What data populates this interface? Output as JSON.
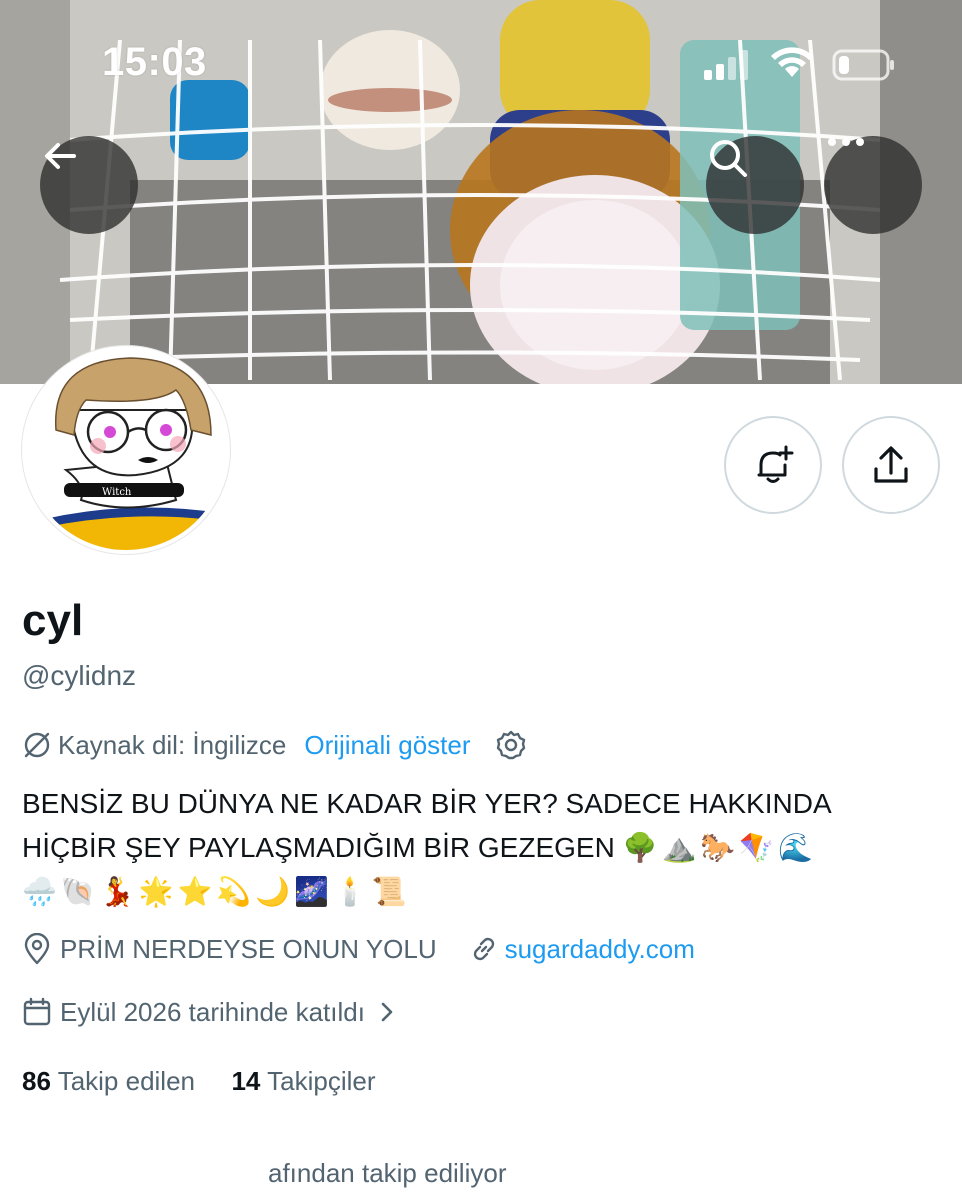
{
  "status_bar": {
    "time": "15:03",
    "icons": [
      "signal-icon",
      "wifi-icon",
      "battery-icon"
    ]
  },
  "header": {
    "icons": [
      "arrow-left-icon",
      "search-icon",
      "more-icon"
    ]
  },
  "actions": {
    "icons": [
      "bell-plus-icon",
      "share-icon"
    ]
  },
  "profile": {
    "name": "cyl",
    "handle": "@cylidnz",
    "avatar_text": "Witch",
    "translate": {
      "source_label": "Kaynak dil: İngilizce",
      "show_original": "Orijinali göster"
    },
    "bio_line1": "BENSİZ BU DÜNYA NE KADAR BİR YER? SADECE HAKKINDA",
    "bio_line2": "HİÇBİR ŞEY PAYLAŞMADIĞIM BİR GEZEGEN",
    "bio_emoji_line2": "🌳⛰️🐎🪁🌊",
    "bio_emoji_line3": "🌧️🐚💃🌟⭐💫🌙🌌🕯️📜",
    "location": "PRİM NERDEYSE ONUN YOLU",
    "website": "sugardaddy.com",
    "joined": "Eylül 2026 tarihinde katıldı",
    "following_count": "86",
    "following_label": "Takip edilen",
    "followers_count": "14",
    "followers_label": "Takipçiler",
    "followed_by": "afından takip ediliyor"
  },
  "colors": {
    "accent": "#1d9bf0",
    "secondary_text": "#536471",
    "primary_text": "#0f1419"
  }
}
